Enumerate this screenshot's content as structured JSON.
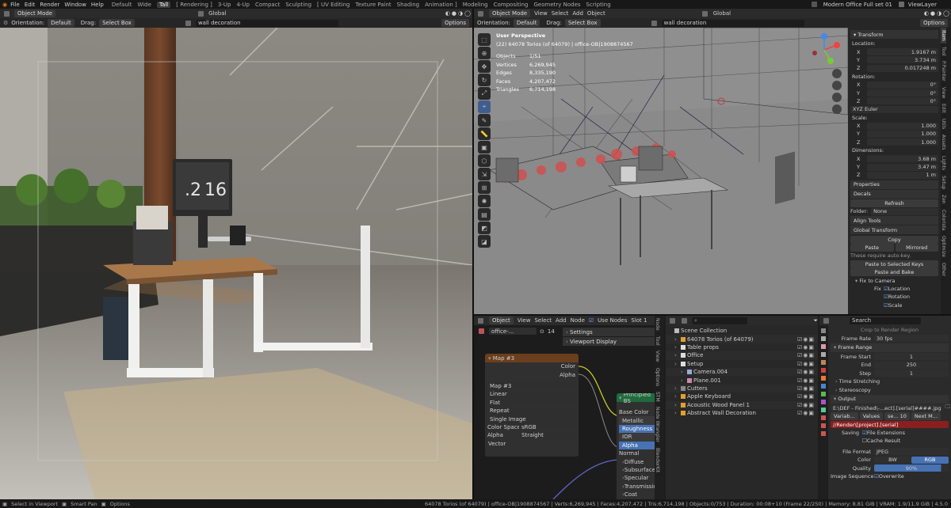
{
  "topbar": {
    "menus": [
      "File",
      "Edit",
      "Render",
      "Window",
      "Help"
    ],
    "workspaces": [
      "Default",
      "Wide",
      "Tall",
      "[ Rendering ]",
      "3-Up",
      "4-Up",
      "Compact",
      "Sculpting",
      "[ UV Editing",
      "Texture Paint",
      "Shading",
      "Animation ]",
      "Modeling",
      "Compositing",
      "Geometry Nodes",
      "Scripting"
    ],
    "active_workspace": "Tall",
    "file_title": "Modern Office Full set 01",
    "view_layer": "ViewLayer"
  },
  "left_view": {
    "mode": "Object Mode",
    "orientation_label": "Orientation:",
    "orientation": "Default",
    "drag_label": "Drag:",
    "drag": "Select Box",
    "transform": "Global",
    "search": "wall decoration",
    "options": "Options",
    "clock_hour": ".2",
    "clock_min": "16"
  },
  "right_view": {
    "mode": "Object Mode",
    "menus": [
      "View",
      "Select",
      "Add",
      "Object"
    ],
    "transform": "Global",
    "search": "wall decoration",
    "orientation_label": "Orientation:",
    "orientation": "Default",
    "drag_label": "Drag:",
    "drag": "Select Box",
    "options": "Options",
    "overlay": {
      "title": "User Perspective",
      "subtitle": "(22) 64078 Torios (of 64079) | office-OB|1908874567",
      "stats": [
        [
          "Objects",
          "1/51"
        ],
        [
          "Vertices",
          "6,269,945"
        ],
        [
          "Edges",
          "8,335,190"
        ],
        [
          "Faces",
          "4,207,472"
        ],
        [
          "Triangles",
          "6,714,198"
        ]
      ]
    }
  },
  "npanel": {
    "tabs": [
      "Item",
      "Tool",
      "P.Painter",
      "View",
      "Edit",
      "Utils",
      "Assets",
      "Lights",
      "Setup",
      "Zen",
      "Colorista",
      "Optimize",
      "Other"
    ],
    "transform_title": "Transform",
    "location_label": "Location:",
    "location": [
      [
        "X",
        "1.9167 m"
      ],
      [
        "Y",
        "3.734 m"
      ],
      [
        "Z",
        "0.017248 m"
      ]
    ],
    "rotation_label": "Rotation:",
    "rotation": [
      [
        "X",
        "0°"
      ],
      [
        "Y",
        "0°"
      ],
      [
        "Z",
        "0°"
      ]
    ],
    "rotation_mode": "XYZ Euler",
    "scale_label": "Scale:",
    "scale": [
      [
        "X",
        "1.000"
      ],
      [
        "Y",
        "1.000"
      ],
      [
        "Z",
        "1.000"
      ]
    ],
    "dimensions_label": "Dimensions:",
    "dimensions": [
      [
        "X",
        "3.68 m"
      ],
      [
        "Y",
        "3.47 m"
      ],
      [
        "Z",
        "1 m"
      ]
    ],
    "properties": "Properties",
    "decals": "Decals",
    "refresh": "Refresh",
    "folder_label": "Folder:",
    "folder": "None",
    "align_tools": "Align Tools",
    "global_transform": "Global Transform",
    "copy": "Copy",
    "paste": "Paste",
    "mirrored": "Mirrored",
    "autokey_note": "These require auto-key.",
    "paste_selected": "Paste to Selected Keys",
    "paste_bake": "Paste and Bake",
    "fix_camera": "Fix to Camera",
    "fix_label": "Fix",
    "fix_location": "Location",
    "fix_rotation": "Rotation",
    "fix_scale": "Scale"
  },
  "node_editor": {
    "header": [
      "Object",
      "View",
      "Select",
      "Add",
      "Node",
      "Use Nodes",
      "Slot 1"
    ],
    "material": "office-...",
    "users": "14",
    "settings": "Settings",
    "viewport_display": "Viewport Display",
    "map_node": {
      "title": "Map #3",
      "out_color": "Color",
      "out_alpha": "Alpha",
      "image": "Map #3",
      "options": [
        "Linear",
        "Flat",
        "Repeat",
        "Single Image"
      ],
      "colorspace_label": "Color Space",
      "colorspace": "sRGB",
      "alpha_label": "Alpha",
      "alpha": "Straight",
      "vector": "Vector"
    },
    "bsdf_node": {
      "title": "Principled BS",
      "inputs": [
        "Base Color",
        "Metallic",
        "Roughness",
        "IOR",
        "Alpha",
        "Normal"
      ],
      "sections": [
        "Diffuse",
        "Subsurface",
        "Specular",
        "Transmission",
        "Coat"
      ]
    },
    "side_tabs": [
      "Node",
      "Tool",
      "View",
      "Options",
      "STM",
      "Node Wrangler",
      "BlenderKit"
    ]
  },
  "outliner": {
    "items": [
      {
        "name": "Scene Collection",
        "indent": 0
      },
      {
        "name": "64078 Torios (of 64079)",
        "indent": 1
      },
      {
        "name": "Table props",
        "indent": 1
      },
      {
        "name": "Office",
        "indent": 1
      },
      {
        "name": "Setup",
        "indent": 1
      },
      {
        "name": "Camera.004",
        "indent": 2
      },
      {
        "name": "Plane.001",
        "indent": 2
      },
      {
        "name": "Cutters",
        "indent": 1
      },
      {
        "name": "Apple Keyboard",
        "indent": 1
      },
      {
        "name": "Acoustic Wood Panel 1",
        "indent": 1
      },
      {
        "name": "Abstract Wall Decoration",
        "indent": 1
      }
    ]
  },
  "props": {
    "search": "Search",
    "crop_region": "Crop to Render Region",
    "frame_rate_label": "Frame Rate",
    "frame_rate": "30 fps",
    "frame_range": "Frame Range",
    "frame_start_label": "Frame Start",
    "frame_start": "1",
    "end_label": "End",
    "end": "250",
    "step_label": "Step",
    "step": "1",
    "time_stretching": "Time Stretching",
    "stereoscopy": "Stereoscopy",
    "output": "Output",
    "path": "E:\\DEF - Finished\\-...ect].[serial]####.jpg",
    "variab": "Variab...",
    "values": "Values",
    "se": "se... 10",
    "next": "Next M...",
    "render_path": "//Render\\[project].[serial]",
    "saving_label": "Saving",
    "file_ext": "File Extensions",
    "cache_result": "Cache Result",
    "file_format_label": "File Format",
    "file_format": "JPEG",
    "color_label": "Color",
    "bw": "BW",
    "rgb": "RGB",
    "quality_label": "Quality",
    "quality": "90%",
    "image_seq_label": "Image Sequence",
    "overwrite": "Overwrite"
  },
  "statusbar": {
    "left": [
      "Select in Viewport",
      "Smart Pan",
      "Options"
    ],
    "right": "64078 Torios (of 64079) | office-OB|1908874567 | Verts:6,269,945 | Faces:4,207,472 | Tris:6,714,198 | Objects:0/753 | Duration: 00:08+10 (Frame 22/250) | Memory: 8.81 GiB | VRAM: 1.9/11.9 GiB | 4.5.0"
  }
}
